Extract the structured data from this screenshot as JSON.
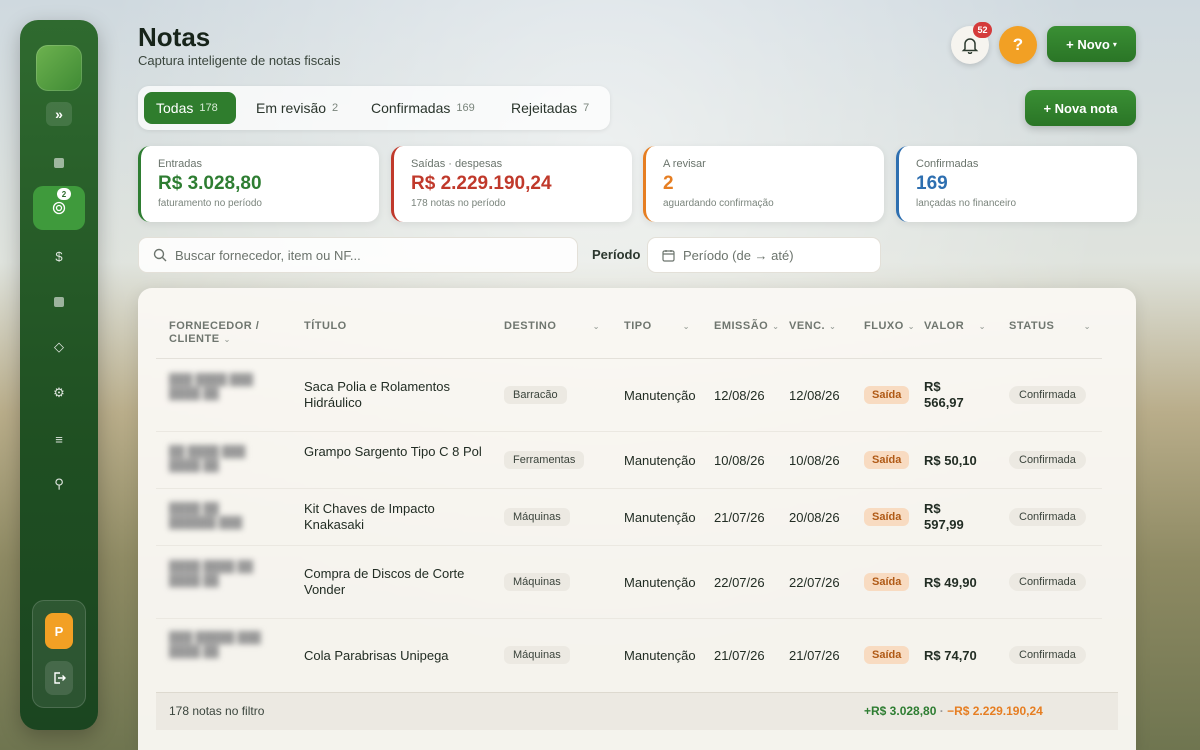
{
  "header": {
    "title": "Notas",
    "subtitle": "Captura inteligente de notas fiscais",
    "notifications_count": "52",
    "help_label": "?",
    "new_label": "+ Novo",
    "new_note_label": "+ Nova nota"
  },
  "sidebar": {
    "expand_label": "»",
    "active_badge": "2",
    "avatar_initial": "P",
    "items": [
      {
        "icon": "square-icon"
      },
      {
        "icon": "target-icon"
      },
      {
        "icon": "dollar-icon",
        "label": "$"
      },
      {
        "icon": "box-icon"
      },
      {
        "icon": "diamond-icon",
        "label": "◇"
      },
      {
        "icon": "gear-icon",
        "label": "⚙"
      },
      {
        "icon": "menu-icon",
        "label": "≡"
      },
      {
        "icon": "pin-icon",
        "label": "⚲"
      }
    ]
  },
  "tabs": [
    {
      "label": "Todas",
      "count": "178"
    },
    {
      "label": "Em revisão",
      "count": "2"
    },
    {
      "label": "Confirmadas",
      "count": "169"
    },
    {
      "label": "Rejeitadas",
      "count": "7"
    }
  ],
  "kpis": [
    {
      "label": "Entradas",
      "value": "R$ 3.028,80",
      "sub": "faturamento no período",
      "color": "#2e7d32"
    },
    {
      "label": "Saídas · despesas",
      "value": "R$ 2.229.190,24",
      "sub": "178 notas no período",
      "color": "#c0392b"
    },
    {
      "label": "A revisar",
      "value": "2",
      "sub": "aguardando confirmação",
      "color": "#e67e22"
    },
    {
      "label": "Confirmadas",
      "value": "169",
      "sub": "lançadas no financeiro",
      "color": "#2e6fb0"
    }
  ],
  "search": {
    "placeholder": "Buscar fornecedor, item ou NF..."
  },
  "period": {
    "label": "Período",
    "placeholder": "Período (de → até)"
  },
  "table": {
    "columns": [
      "FORNECEDOR / CLIENTE",
      "TÍTULO",
      "DESTINO",
      "TIPO",
      "EMISSÃO",
      "VENC.",
      "FLUXO",
      "VALOR",
      "STATUS"
    ],
    "rows": [
      {
        "supplier": "███ ████ ███ ████ ██",
        "title": "Saca Polia e Rolamentos Hidráulico",
        "destino": "Barracão",
        "tipo": "Manutenção",
        "emissao": "12/08/26",
        "venc": "12/08/26",
        "fluxo": "Saída",
        "valor": "R$ 566,97",
        "status": "Confirmada"
      },
      {
        "supplier": "██ ████ ███ ████ ██",
        "title": "Grampo Sargento Tipo C 8 Pol",
        "destino": "Ferramentas",
        "tipo": "Manutenção",
        "emissao": "10/08/26",
        "venc": "10/08/26",
        "fluxo": "Saída",
        "valor": "R$ 50,10",
        "status": "Confirmada"
      },
      {
        "supplier": "████ ██ ██████ ███",
        "title": "Kit Chaves de Impacto Knakasaki",
        "destino": "Máquinas",
        "tipo": "Manutenção",
        "emissao": "21/07/26",
        "venc": "20/08/26",
        "fluxo": "Saída",
        "valor": "R$ 597,99",
        "status": "Confirmada"
      },
      {
        "supplier": "████ ████ ██ ████ ██",
        "title": "Compra de Discos de Corte Vonder",
        "destino": "Máquinas",
        "tipo": "Manutenção",
        "emissao": "22/07/26",
        "venc": "22/07/26",
        "fluxo": "Saída",
        "valor": "R$ 49,90",
        "status": "Confirmada"
      },
      {
        "supplier": "███ █████ ███ ████ ██",
        "title": "Cola Parabrisas Unipega",
        "destino": "Máquinas",
        "tipo": "Manutenção",
        "emissao": "21/07/26",
        "venc": "21/07/26",
        "fluxo": "Saída",
        "valor": "R$ 74,70",
        "status": "Confirmada"
      }
    ],
    "footer_count": "178 notas no filtro",
    "footer_in": "+R$ 3.028,80",
    "footer_sep": " · ",
    "footer_out": "−R$ 2.229.190,24"
  }
}
